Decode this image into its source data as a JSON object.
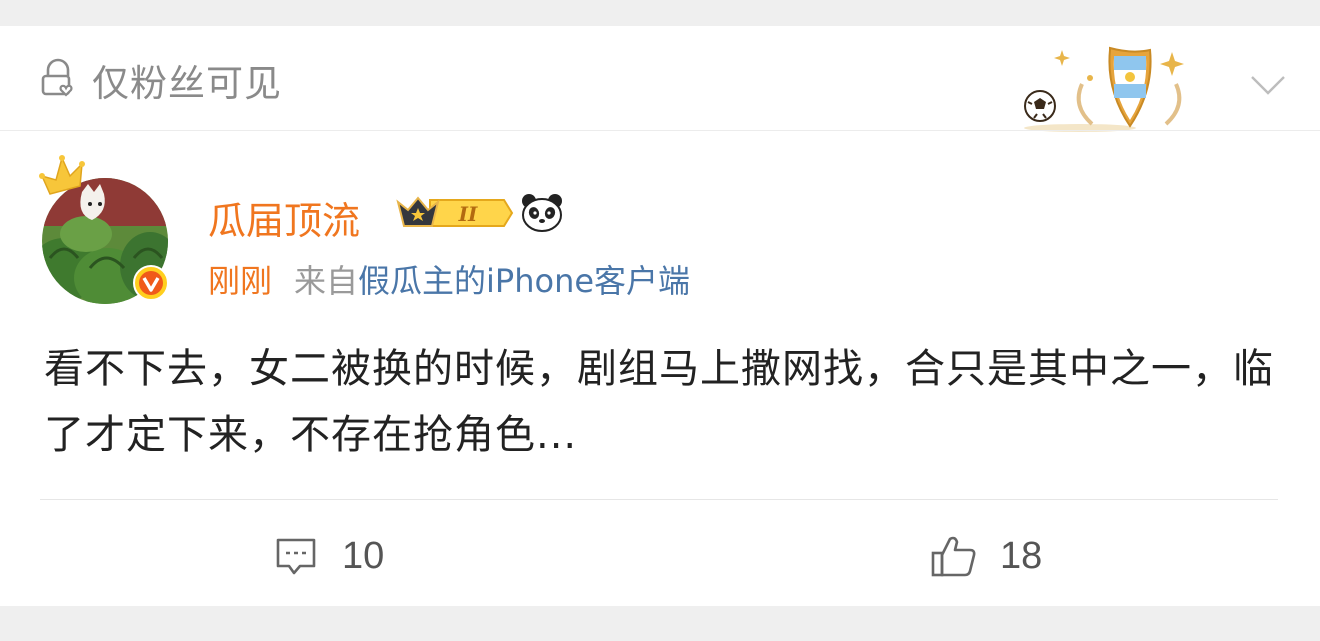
{
  "header": {
    "visibility_label": "仅粉丝可见",
    "lock_icon": "lock-heart-icon",
    "medal_icon": "argentina-football-medal-icon",
    "expand_icon": "chevron-down-icon"
  },
  "author": {
    "name": "瓜届顶流",
    "level_badge_text": "II",
    "avatar_desc": "avatar",
    "emoji_icon": "panda-icon",
    "verify_icon": "verified-v-badge-icon"
  },
  "meta": {
    "time": "刚刚",
    "from_prefix": "来自",
    "source": "假瓜主的iPhone客户端"
  },
  "post": {
    "text": "看不下去，女二被换的时候，剧组马上撒网找，合只是其中之一，临了才定下来，不存在抢角色..."
  },
  "actions": {
    "comment_count": "10",
    "like_count": "18"
  },
  "colors": {
    "accent_orange": "#f0761f",
    "link_blue": "#4a76a8",
    "muted_gray": "#8a8a8a",
    "background": "#efefef"
  }
}
